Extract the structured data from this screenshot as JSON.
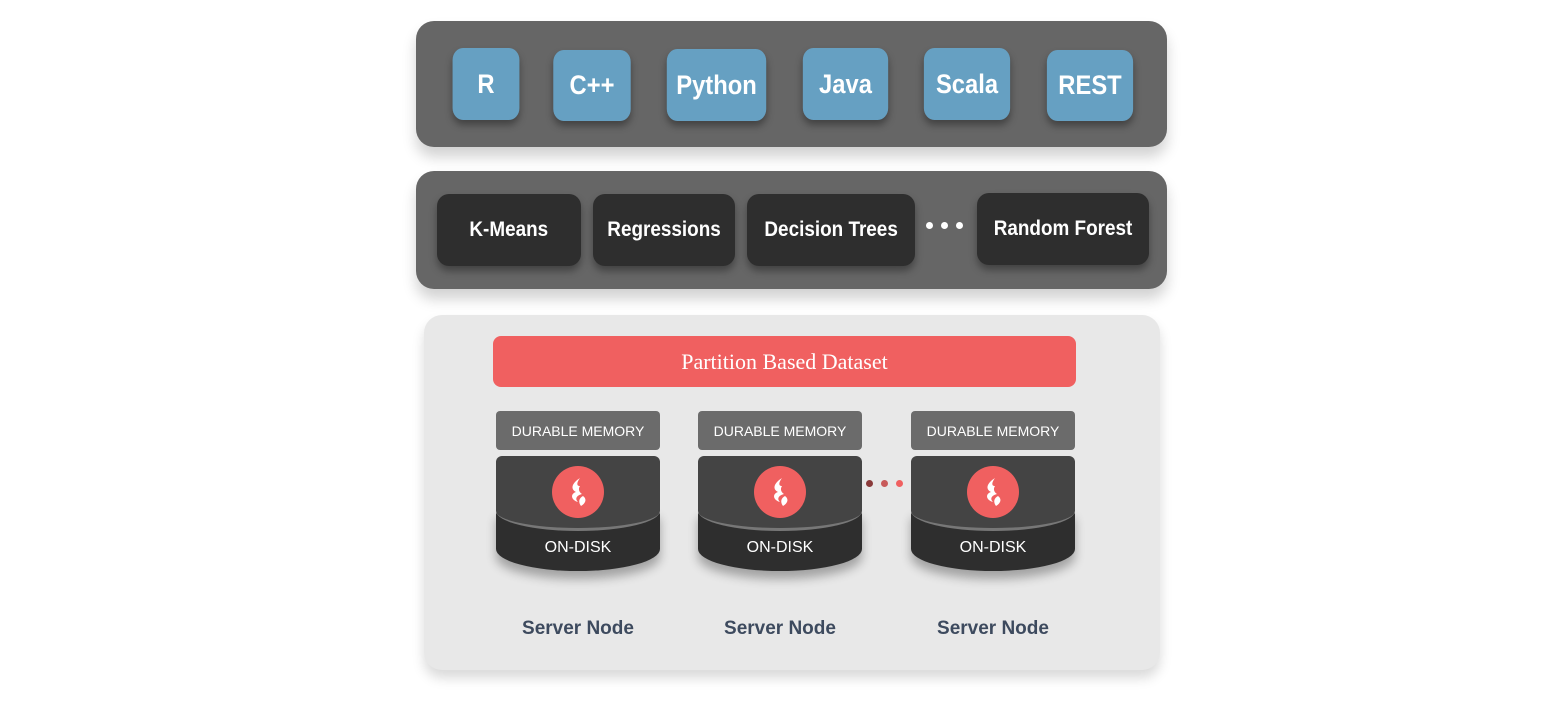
{
  "languages": [
    "R",
    "C++",
    "Python",
    "Java",
    "Scala",
    "REST"
  ],
  "algorithms": [
    "K-Means",
    "Regressions",
    "Decision Trees",
    "Random Forest"
  ],
  "dataset_label": "Partition Based Dataset",
  "nodes": [
    {
      "memory": "DURABLE MEMORY",
      "disk": "ON-DISK",
      "label": "Server Node"
    },
    {
      "memory": "DURABLE MEMORY",
      "disk": "ON-DISK",
      "label": "Server Node"
    },
    {
      "memory": "DURABLE MEMORY",
      "disk": "ON-DISK",
      "label": "Server Node"
    }
  ],
  "colors": {
    "language": "#66a0c2",
    "algorithm": "#2e2e2e",
    "dataset": "#f06060",
    "panel": "#666666"
  },
  "icons": {
    "node_logo": "flame-icon",
    "ellipsis": "ellipsis-icon"
  }
}
